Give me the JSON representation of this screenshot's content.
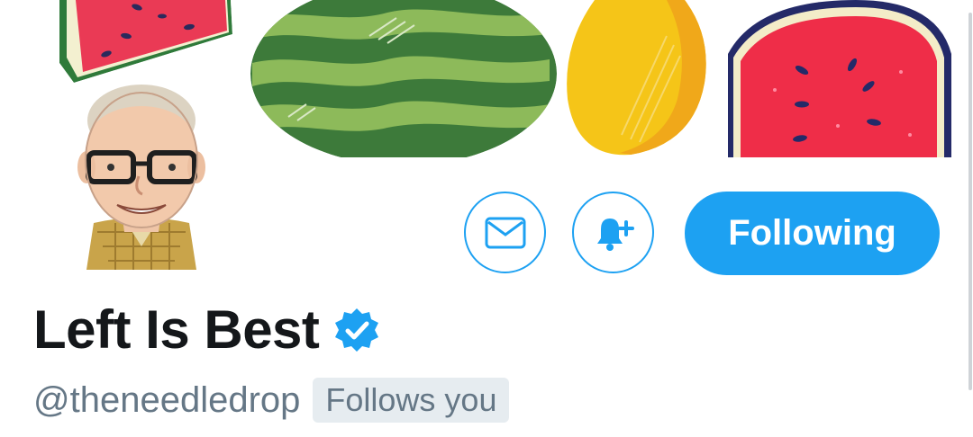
{
  "profile": {
    "display_name": "Left Is Best",
    "handle": "@theneedledrop",
    "follows_you_label": "Follows you",
    "verified": true
  },
  "actions": {
    "message_icon": "envelope-icon",
    "notify_icon": "bell-plus-icon",
    "follow_label": "Following"
  },
  "colors": {
    "accent": "#1da1f2",
    "name_text": "#14171a",
    "secondary_text": "#657786",
    "badge_bg": "#e6ecf0"
  }
}
